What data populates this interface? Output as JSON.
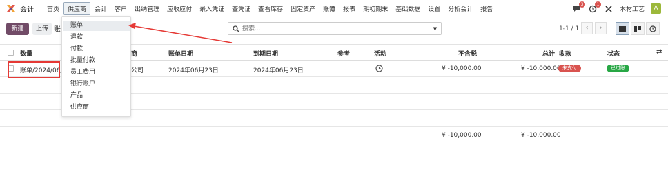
{
  "nav": {
    "app_name": "会计",
    "menu": [
      "首页",
      "供应商",
      "会计",
      "客户",
      "出纳管理",
      "应收应付",
      "录入凭证",
      "查凭证",
      "查看库存",
      "固定资产",
      "账簿",
      "报表",
      "期初期末",
      "基础数据",
      "设置",
      "分析会计",
      "报告"
    ],
    "messages_count": "3",
    "activities_count": "1",
    "company": "木材工艺",
    "avatar_letter": "A"
  },
  "control": {
    "new_label": "新建",
    "upload_label": "上传",
    "breadcrumb": "账",
    "search_placeholder": "搜索...",
    "pager": "1-1 / 1"
  },
  "table": {
    "headers": {
      "number": "数量",
      "partner": "商",
      "bill_date": "账单日期",
      "due_date": "到期日期",
      "reference": "参考",
      "activity": "活动",
      "untaxed": "不含税",
      "total": "总计",
      "payment": "收款",
      "status": "状态"
    },
    "rows": [
      {
        "number": "账单/2024/06/(",
        "partner": "公司",
        "bill_date": "2024年06月23日",
        "due_date": "2024年06月23日",
        "untaxed": "¥ -10,000.00",
        "total": "¥ -10,000.00",
        "payment": "未支付",
        "status": "已过账"
      }
    ],
    "totals": {
      "untaxed": "¥ -10,000.00",
      "total": "¥ -10,000.00"
    }
  },
  "dropdown": {
    "items": [
      "账单",
      "退款",
      "付款",
      "批量付款",
      "员工费用",
      "银行账户",
      "产品",
      "供应商"
    ]
  },
  "colors": {
    "primary": "#714b67",
    "unpaid": "#d9534f",
    "posted": "#28a745",
    "annotation": "#e53935"
  }
}
